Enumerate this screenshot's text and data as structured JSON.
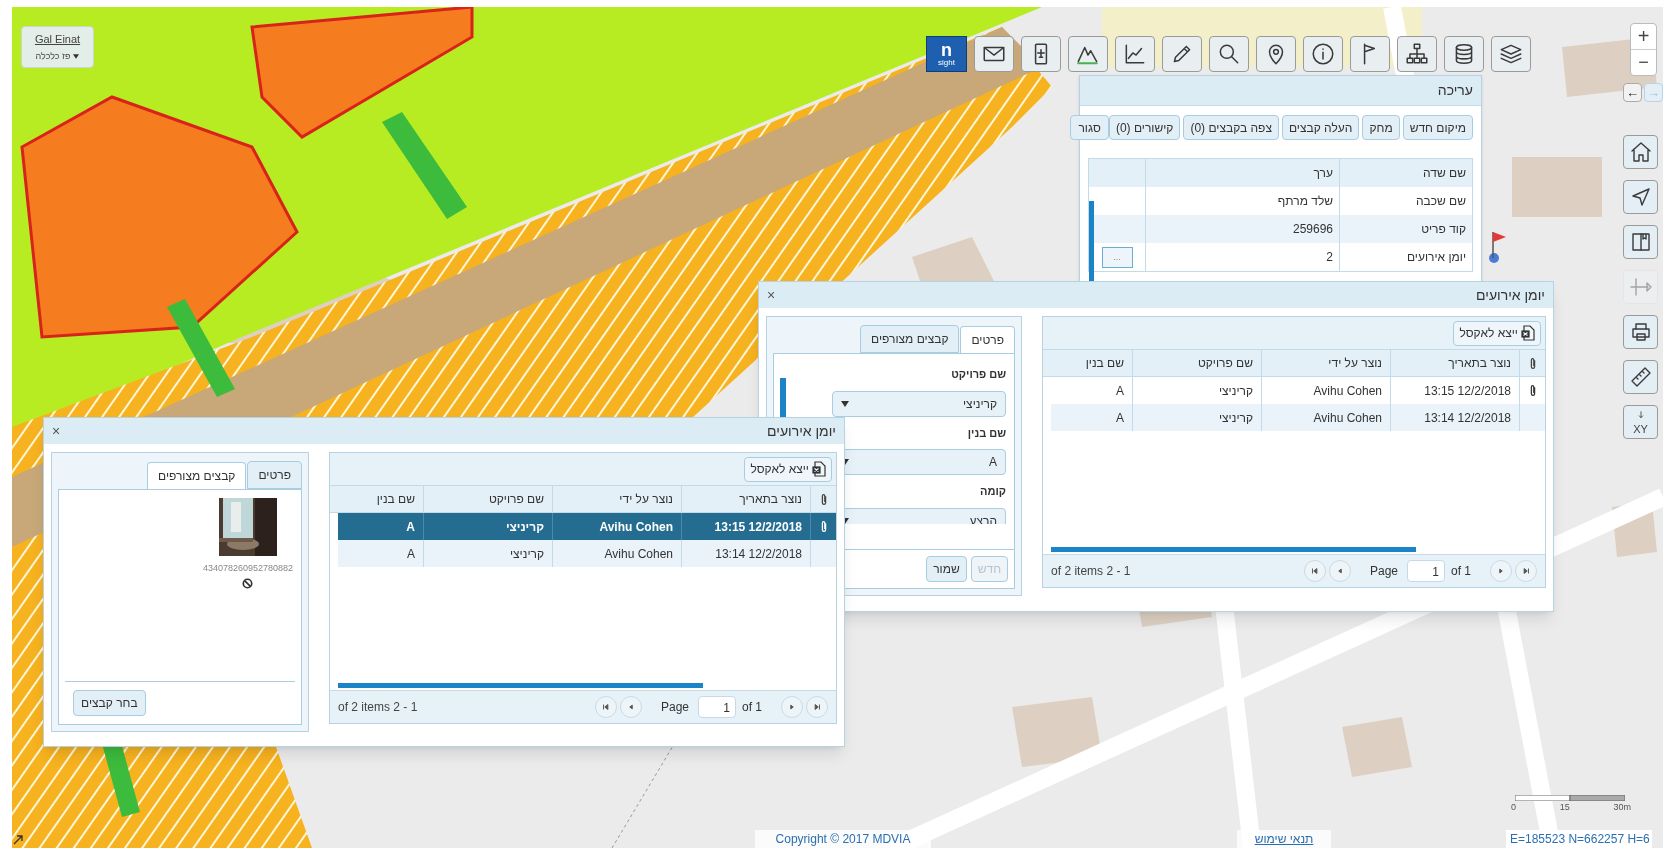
{
  "user_menu": {
    "name": "Gal Einat",
    "organization": "פז כלכלה"
  },
  "logo": {
    "mark": "n",
    "text": "sight"
  },
  "toolbar": [
    {
      "kind": "envelope"
    },
    {
      "kind": "plane-document"
    },
    {
      "kind": "mountains"
    },
    {
      "kind": "line-chart"
    },
    {
      "kind": "pencil"
    },
    {
      "kind": "search"
    },
    {
      "kind": "pin"
    },
    {
      "kind": "info"
    },
    {
      "kind": "flag"
    },
    {
      "kind": "hierarchy"
    },
    {
      "kind": "database"
    },
    {
      "kind": "layers"
    }
  ],
  "zoom": {
    "plus": "+",
    "minus": "−"
  },
  "history": {
    "back": {
      "label": "←",
      "disabled": false
    },
    "forward": {
      "label": "→",
      "disabled": true
    }
  },
  "side_tools": [
    {
      "kind": "home",
      "disabled": false
    },
    {
      "kind": "pointer",
      "disabled": false
    },
    {
      "kind": "book",
      "disabled": false
    },
    {
      "kind": "distance",
      "disabled": true
    },
    {
      "kind": "printer",
      "disabled": false
    },
    {
      "kind": "ruler",
      "disabled": false
    },
    {
      "kind": "xy",
      "label": "XY",
      "disabled": false
    }
  ],
  "edit_panel": {
    "title": "עריכה",
    "buttons": [
      "מיקום חדש",
      "מחק",
      "העלה קבצים",
      "צפה בקבצים (0)",
      "קישורים (0)"
    ],
    "close": "סגור",
    "columns": [
      "שם שדה",
      "ערך"
    ],
    "rows": [
      {
        "field": "שם שכבה",
        "value": "שלד מרתף"
      },
      {
        "field": "קוד פריט",
        "value": "259696"
      },
      {
        "field": "יומן אירועים",
        "value": "2",
        "action": "..."
      }
    ]
  },
  "windows": [
    {
      "title": "יומן אירועים",
      "close": "×",
      "export": "ייצא לאקסל",
      "columns": [
        "נוצר בתאריך",
        "נוצר על ידי",
        "שם פרויקט",
        "שם בנין"
      ],
      "rows": [
        {
          "attachment": true,
          "created": "13:15 12/2/2018",
          "by": "Avihu Cohen",
          "project": "קריניצי",
          "building": "A",
          "selected": false
        },
        {
          "attachment": false,
          "created": "13:14 12/2/2018",
          "by": "Avihu Cohen",
          "project": "קריניצי",
          "building": "A",
          "selected": false
        }
      ],
      "pager": {
        "summary": "of 2 items 2 - 1",
        "page_label": "Page",
        "page": "1",
        "total": "of 1"
      },
      "tabs": [
        {
          "label": "פרטים",
          "selected": true
        },
        {
          "label": "קבצים מצורפים",
          "selected": false
        }
      ],
      "form": {
        "fields": [
          {
            "label": "שם פרויקט",
            "value": "קריניצי"
          },
          {
            "label": "שם בנין",
            "value": "A"
          },
          {
            "label": "קומה",
            "value": "הרצע"
          }
        ],
        "buttons": [
          {
            "label": "חדש",
            "disabled": true
          },
          {
            "label": "שמור",
            "disabled": false
          }
        ]
      }
    },
    {
      "title": "יומן אירועים",
      "close": "×",
      "export": "ייצא לאקסל",
      "columns": [
        "נוצר בתאריך",
        "נוצר על ידי",
        "שם פרויקט",
        "שם בנין"
      ],
      "rows": [
        {
          "attachment": true,
          "created": "13:15 12/2/2018",
          "by": "Avihu Cohen",
          "project": "קריניצי",
          "building": "A",
          "selected": true
        },
        {
          "attachment": false,
          "created": "13:14 12/2/2018",
          "by": "Avihu Cohen",
          "project": "קריניצי",
          "building": "A",
          "selected": false
        }
      ],
      "pager": {
        "summary": "of 2 items 2 - 1",
        "page_label": "Page",
        "page": "1",
        "total": "of 1"
      },
      "tabs": [
        {
          "label": "פרטים",
          "selected": false
        },
        {
          "label": "קבצים מצורפים",
          "selected": true
        }
      ],
      "files": {
        "items": [
          {
            "kind": "picture",
            "name": "434078260952780882"
          }
        ],
        "button": "בחר קבצים"
      }
    }
  ],
  "scale_bar": {
    "start": "0",
    "middle": "15",
    "end": "30m"
  },
  "footer": {
    "copyright": "Copyright © 2017 MDVIA",
    "terms": "תנאי שימוש",
    "coordinates": "E=185523 N=662257 H=6"
  }
}
